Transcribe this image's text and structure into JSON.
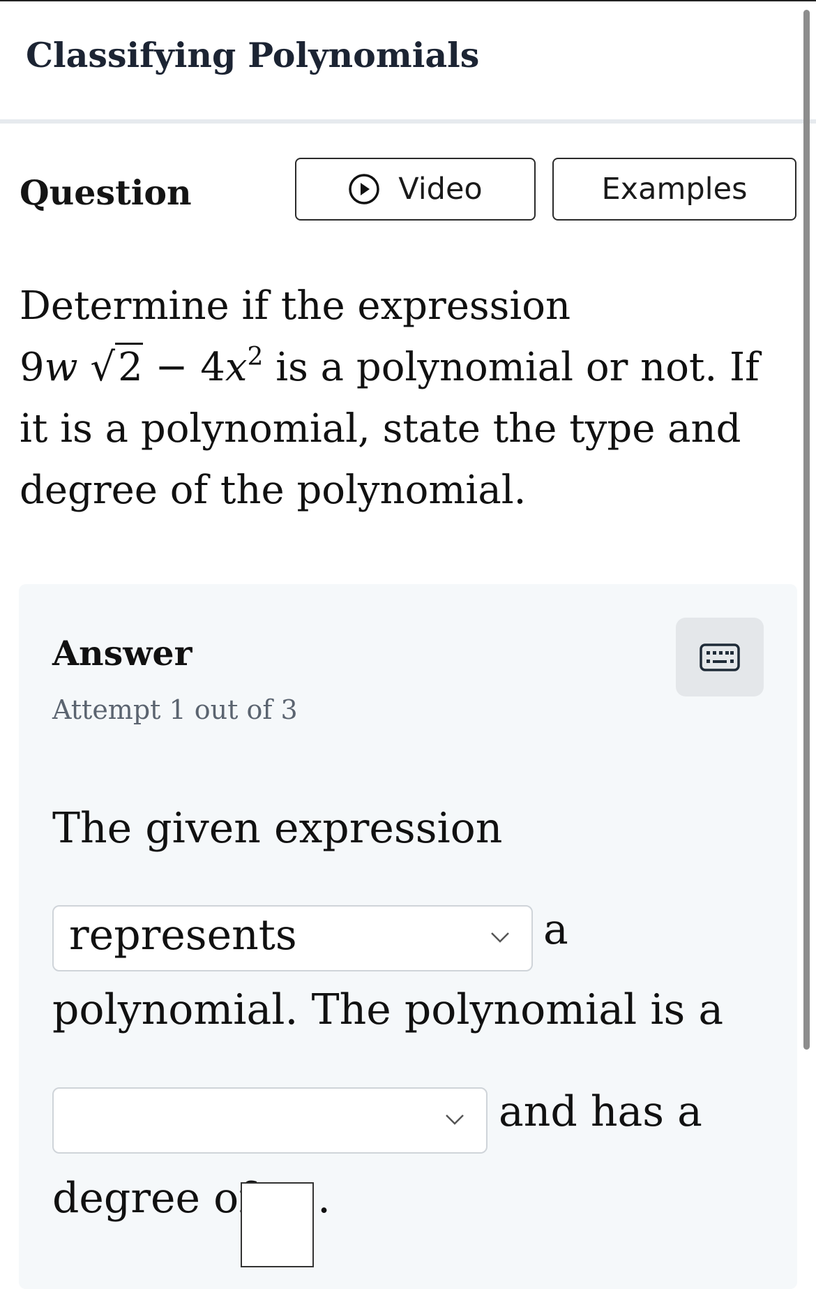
{
  "header": {
    "title": "Classifying Polynomials"
  },
  "question": {
    "label": "Question",
    "video_button": "Video",
    "examples_button": "Examples",
    "prompt_before": "Determine if the expression",
    "prompt_after": "is a polynomial or not. If it is a polynomial, state the type and degree of the polynomial.",
    "expression": {
      "term1_coef": "9",
      "term1_var": "w",
      "radical": "2",
      "operator": "−",
      "term2_coef": "4",
      "term2_var": "x",
      "term2_exp": "2"
    }
  },
  "answer": {
    "label": "Answer",
    "attempt": "Attempt 1 out of 3",
    "sentence_1": "The given expression",
    "dropdown_1_value": "represents",
    "after_dropdown_1": "a",
    "sentence_2": "polynomial. The polynomial is a",
    "dropdown_2_value": "",
    "after_dropdown_2": "and has a",
    "sentence_3": "degree of",
    "degree_value": "",
    "period": "."
  },
  "icons": {
    "video": "play-circle-icon",
    "keyboard": "keyboard-icon",
    "dropdown": "chevron-down-icon"
  },
  "colors": {
    "title": "#1c2433",
    "divider": "#e6eaee",
    "answer_background": "#f5f8fa",
    "attempt_text": "#5b6470",
    "keyboard_button": "#e4e7ea"
  }
}
